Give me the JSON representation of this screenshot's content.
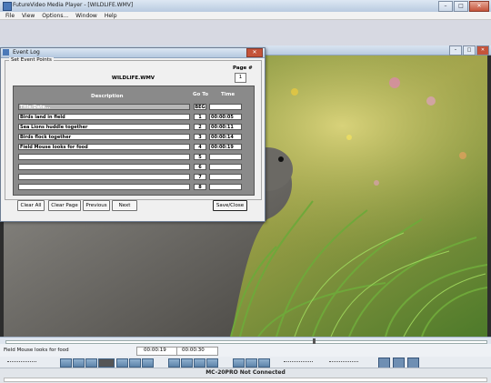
{
  "window": {
    "title": "FutureVideo Media Player - [WILDLIFE.WMV]"
  },
  "menu": [
    "File",
    "View",
    "Options...",
    "Window",
    "Help"
  ],
  "dialog": {
    "title": "Event Log",
    "group_label": "Set Event Points",
    "filename": "WILDLIFE.WMV",
    "page_label": "Page #",
    "page_value": "1",
    "headers": {
      "description": "Description",
      "goto": "Go To",
      "time": "Time"
    },
    "first_row": {
      "description": "Title/Date...",
      "goto": "BEG",
      "time": ""
    },
    "rows": [
      {
        "description": "Birds land in field",
        "goto": "1",
        "time": "00:00:05"
      },
      {
        "description": "Sea Lions huddle together",
        "goto": "2",
        "time": "00:00:11"
      },
      {
        "description": "Birds flock together",
        "goto": "3",
        "time": "00:00:14"
      },
      {
        "description": "Field Mouse looks for food",
        "goto": "4",
        "time": "00:00:19"
      },
      {
        "description": "",
        "goto": "5",
        "time": ""
      },
      {
        "description": "",
        "goto": "6",
        "time": ""
      },
      {
        "description": "",
        "goto": "7",
        "time": ""
      },
      {
        "description": "",
        "goto": "8",
        "time": ""
      }
    ],
    "buttons": {
      "clear_all": "Clear All",
      "clear_page": "Clear Page",
      "previous": "Previous",
      "next": "Next",
      "save_close": "Save/Close"
    }
  },
  "status": {
    "current_event": "Field Mouse looks for food",
    "current_time": "00:00:19",
    "total_time": "00:00:30",
    "playback_progress": 0.64
  },
  "connection": {
    "text": "MC-20PRO Not Connected"
  }
}
